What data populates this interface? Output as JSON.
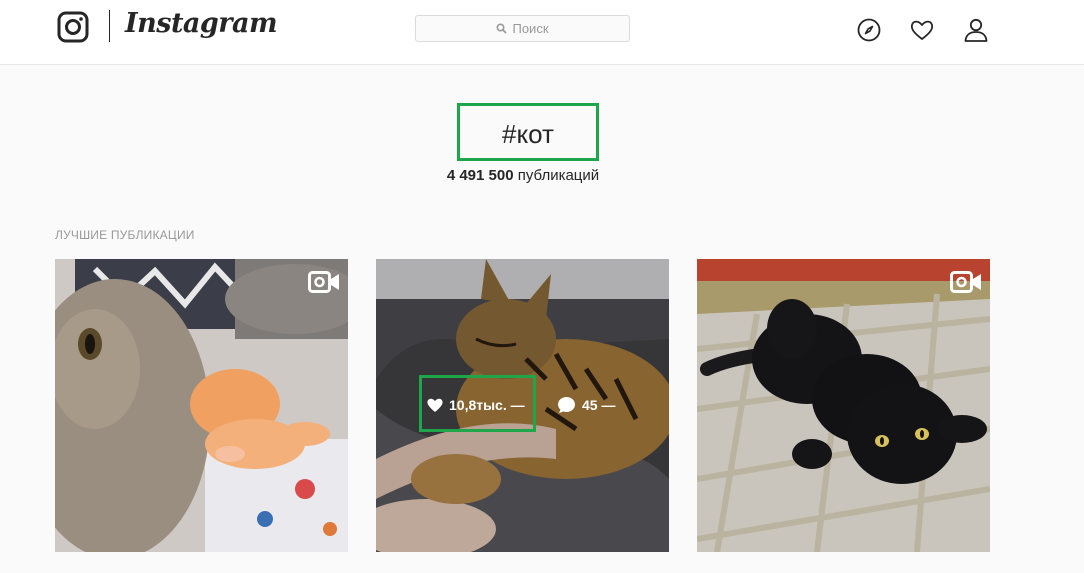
{
  "header": {
    "logo_text": "Instagram",
    "search_placeholder": "Поиск",
    "icons": [
      "instagram-camera-icon",
      "search-icon",
      "compass-icon",
      "heart-icon",
      "user-icon"
    ]
  },
  "hashtag": {
    "title": "#кот",
    "count": "4 491 500",
    "count_label": "публикаций"
  },
  "section": {
    "label": "ЛУЧШИЕ ПУБЛИКАЦИИ"
  },
  "posts": [
    {
      "type": "video",
      "icon": "video-camera-icon"
    },
    {
      "type": "photo",
      "likes": "10,8тыс. —",
      "comments": "45 —"
    },
    {
      "type": "video",
      "icon": "video-camera-icon"
    }
  ],
  "colors": {
    "highlight": "#1fa64a",
    "text": "#262626",
    "muted": "#999999"
  }
}
